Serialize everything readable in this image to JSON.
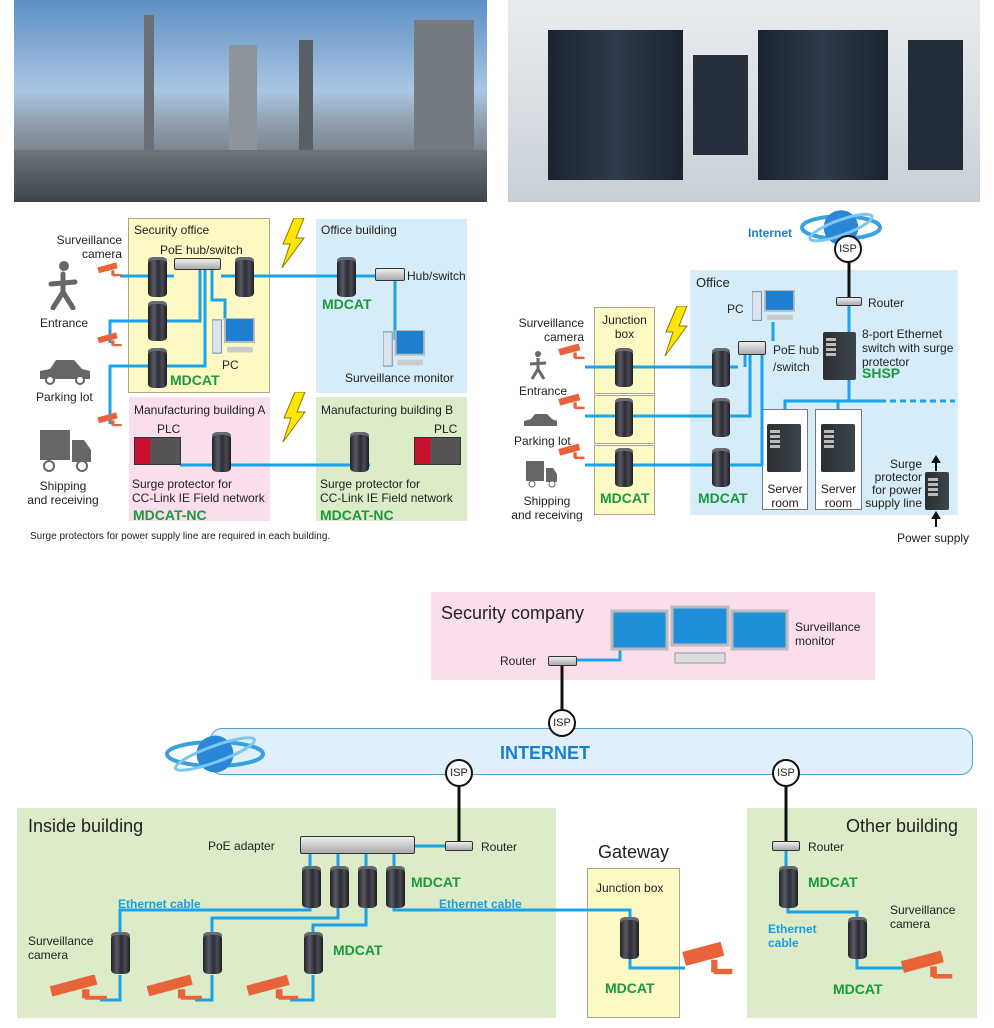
{
  "colors": {
    "cable": "#1aa3e8",
    "product": "#1a9a3c",
    "camera": "#e8623a",
    "internet_text": "#1a7fd1"
  },
  "diagram1": {
    "left": {
      "camera": "Surveillance\ncamera",
      "entrance": "Entrance",
      "parking": "Parking lot",
      "shipping": "Shipping\nand receiving"
    },
    "security_office": {
      "title": "Security office",
      "hub": "PoE hub/switch",
      "pc": "PC",
      "product": "MDCAT"
    },
    "office_building": {
      "title": "Office building",
      "hub": "Hub/switch",
      "product": "MDCAT",
      "monitor": "Surveillance monitor"
    },
    "mfg_a": {
      "title": "Manufacturing building A",
      "plc": "PLC",
      "desc": "Surge protector for\nCC-Link IE Field network",
      "product": "MDCAT-NC"
    },
    "mfg_b": {
      "title": "Manufacturing building B",
      "plc": "PLC",
      "desc": "Surge protector for\nCC-Link IE Field network",
      "product": "MDCAT-NC"
    },
    "footnote": "Surge protectors for power supply line are required in each building."
  },
  "diagram2": {
    "internet": "Internet",
    "isp": "ISP",
    "office": "Office",
    "router": "Router",
    "pc": "PC",
    "switch_desc": "8-port Ethernet\nswitch with surge\nprotector",
    "switch_product": "SHSP",
    "poe_hub": "PoE hub\n/switch",
    "camera": "Surveillance\ncamera",
    "junction_box": "Junction\nbox",
    "entrance": "Entrance",
    "parking": "Parking lot",
    "shipping": "Shipping\nand receiving",
    "product_junction": "MDCAT",
    "product_office": "MDCAT",
    "server_room": "Server\nroom",
    "power_protector": "Surge\nprotector\nfor power\nsupply line",
    "power_supply": "Power supply"
  },
  "diagram3": {
    "security_company": "Security company",
    "router": "Router",
    "monitor": "Surveillance\nmonitor",
    "isp": "ISP",
    "internet": "INTERNET",
    "inside": {
      "title": "Inside building",
      "poe_adapter": "PoE adapter",
      "router": "Router",
      "product": "MDCAT",
      "cable": "Ethernet cable",
      "product2": "MDCAT",
      "camera": "Surveillance\ncamera",
      "cable2": "Ethernet cable"
    },
    "gateway": {
      "title": "Gateway",
      "junction_box": "Junction box",
      "product": "MDCAT"
    },
    "other": {
      "title": "Other building",
      "router": "Router",
      "product": "MDCAT",
      "cable": "Ethernet\ncable",
      "camera": "Surveillance\ncamera",
      "product2": "MDCAT"
    }
  }
}
